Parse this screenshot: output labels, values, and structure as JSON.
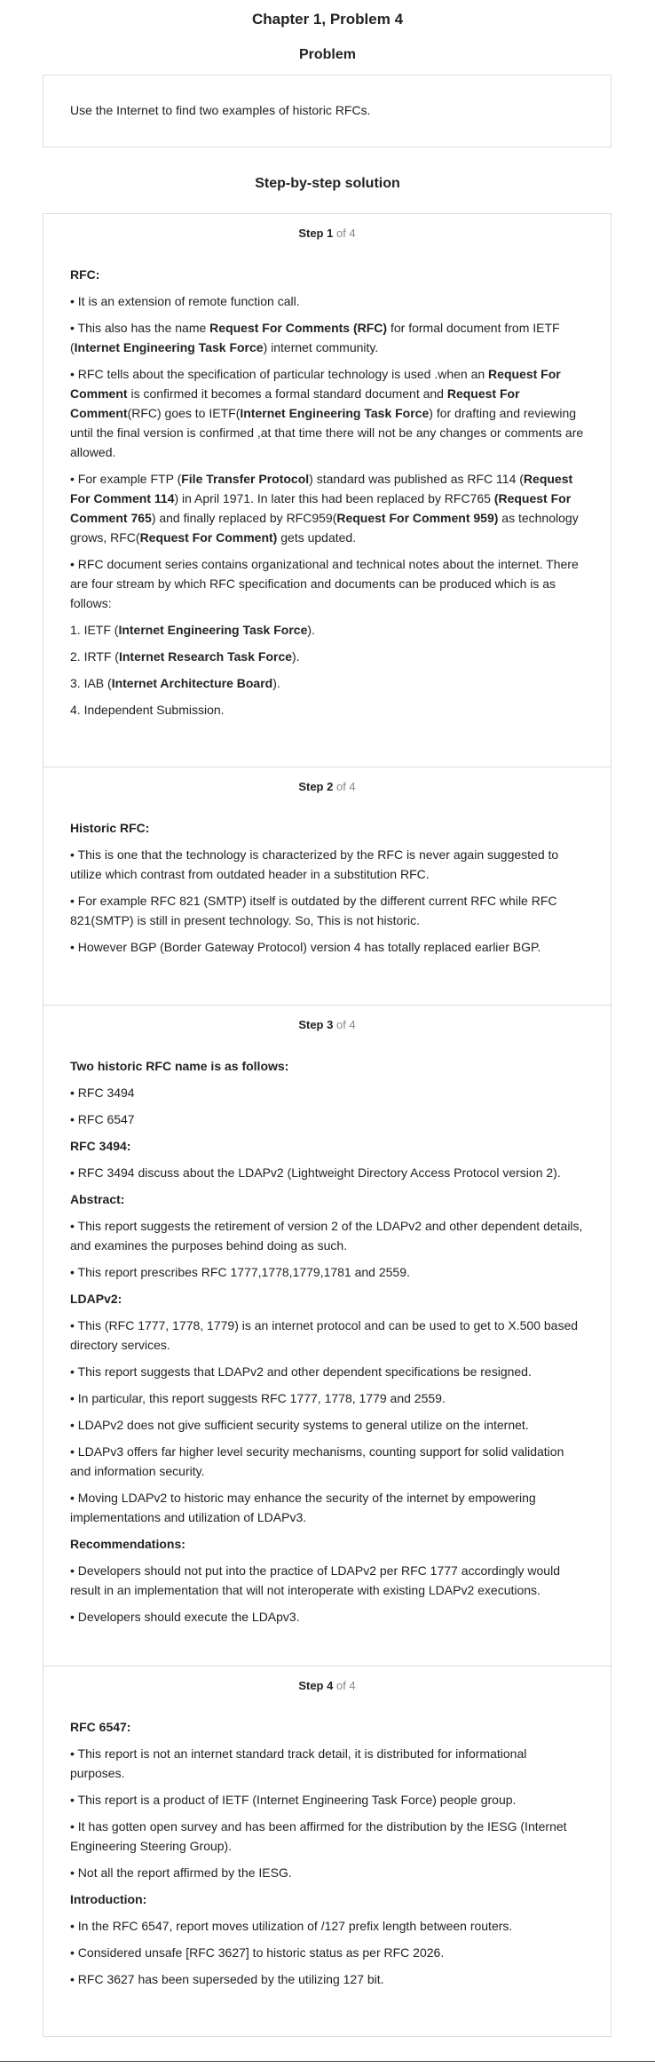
{
  "chapter_title": "Chapter 1, Problem 4",
  "problem": {
    "heading": "Problem",
    "text": "Use the Internet to find two examples of historic RFCs."
  },
  "solution_heading": "Step-by-step solution",
  "steps": [
    {
      "step_label": "Step 1",
      "of_label": "of 4",
      "paragraphs": [
        {
          "bold": true,
          "html": "RFC:"
        },
        {
          "html": "• It is an extension of remote function call."
        },
        {
          "html": "• This also has the name <b>Request For Comments (RFC)</b> for formal document from IETF (<b>Internet Engineering Task Force</b>) internet community."
        },
        {
          "html": "• RFC tells about the specification of particular technology is used .when an <b>Request For Comment</b> is confirmed it becomes a formal standard document and <b>Request For Comment</b>(RFC) goes to IETF(<b>Internet Engineering Task Force</b>) for drafting and reviewing until the final version is confirmed ,at that time there will not be any changes or comments are allowed."
        },
        {
          "html": "• For example FTP (<b>File Transfer Protocol</b>) standard was published as RFC 114 (<b>Request For Comment 114</b>) in April 1971. In later this had been replaced by RFC765 <b>(Request For Comment 765</b>) and finally replaced by RFC959(<b>Request For Comment 959)</b> as technology grows, RFC(<b>Request For Comment)</b> gets updated."
        },
        {
          "html": "• RFC document series contains organizational and technical notes about the internet. There are four stream by which RFC specification and documents can be produced which is as follows:"
        },
        {
          "html": "1. IETF (<b>Internet Engineering Task Force</b>)."
        },
        {
          "html": "2. IRTF (<b>Internet Research Task Force</b>)."
        },
        {
          "html": "3. IAB (<b>Internet Architecture Board</b>)."
        },
        {
          "html": "4. Independent Submission."
        }
      ]
    },
    {
      "step_label": "Step 2",
      "of_label": "of 4",
      "paragraphs": [
        {
          "bold": true,
          "html": "Historic RFC:"
        },
        {
          "html": "• This is one that the technology is characterized by the RFC is never again suggested to utilize which contrast from outdated header in a substitution RFC."
        },
        {
          "html": "• For example RFC 821 (SMTP) itself is outdated by the different current RFC while RFC 821(SMTP) is still in present technology. So, This is not historic."
        },
        {
          "html": "• However BGP (Border Gateway Protocol) version 4 has totally replaced earlier BGP."
        }
      ]
    },
    {
      "step_label": "Step 3",
      "of_label": "of 4",
      "paragraphs": [
        {
          "bold": true,
          "html": "Two historic RFC name is as follows:"
        },
        {
          "html": "• RFC 3494"
        },
        {
          "html": "• RFC 6547"
        },
        {
          "bold": true,
          "html": "RFC 3494:"
        },
        {
          "html": "• RFC 3494 discuss about the LDAPv2 (Lightweight Directory Access Protocol version 2)."
        },
        {
          "bold": true,
          "html": "Abstract:"
        },
        {
          "html": "• This report suggests the retirement of version 2 of the LDAPv2 and other dependent details, and examines the purposes behind doing as such."
        },
        {
          "html": "• This report prescribes RFC 1777,1778,1779,1781 and 2559."
        },
        {
          "bold": true,
          "html": "LDAPv2:"
        },
        {
          "html": "• This (RFC 1777, 1778, 1779) is an internet protocol and can be used to get to X.500 based directory services."
        },
        {
          "html": "• This report suggests that LDAPv2 and other dependent specifications be resigned."
        },
        {
          "html": "• In particular, this report suggests RFC 1777, 1778, 1779 and 2559."
        },
        {
          "html": "• LDAPv2 does not give sufficient security systems to general utilize on the internet."
        },
        {
          "html": "• LDAPv3 offers far higher level security mechanisms, counting support for solid validation and information security."
        },
        {
          "html": "• Moving LDAPv2 to historic may enhance the security of the internet by empowering implementations and utilization of LDAPv3."
        },
        {
          "bold": true,
          "html": "Recommendations:"
        },
        {
          "html": "• Developers should not put into the practice of LDAPv2 per RFC 1777 accordingly would result in an implementation that will not interoperate with existing LDAPv2 executions."
        },
        {
          "html": "• Developers should execute the LDApv3."
        }
      ]
    },
    {
      "step_label": "Step 4",
      "of_label": "of 4",
      "paragraphs": [
        {
          "bold": true,
          "html": "RFC 6547:"
        },
        {
          "html": "• This report is not an internet standard track detail, it is distributed for informational purposes."
        },
        {
          "html": "• This report is a product of IETF (Internet Engineering Task Force) people group."
        },
        {
          "html": "• It has gotten open survey and has been affirmed for the distribution by the IESG (Internet Engineering Steering Group)."
        },
        {
          "html": "• Not all the report affirmed by the IESG."
        },
        {
          "bold": true,
          "html": "Introduction:"
        },
        {
          "html": "• In the RFC 6547, report moves utilization of /127 prefix length between routers."
        },
        {
          "html": "• Considered unsafe [RFC 3627] to historic status as per RFC 2026."
        },
        {
          "html": "• RFC 3627 has been superseded by the utilizing 127 bit."
        }
      ]
    }
  ]
}
